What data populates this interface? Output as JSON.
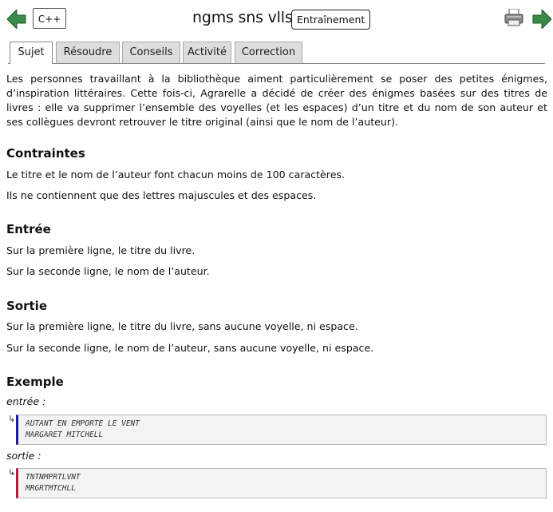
{
  "header": {
    "language": "C++",
    "title": "ngms sns vlls",
    "mode": "Entraînement"
  },
  "tabs": [
    {
      "label": "Sujet",
      "active": true
    },
    {
      "label": "Résoudre",
      "active": false
    },
    {
      "label": "Conseils",
      "active": false
    },
    {
      "label": "Activité",
      "active": false
    },
    {
      "label": "Correction",
      "active": false
    }
  ],
  "statement": {
    "intro": "Les personnes travaillant à la bibliothèque aiment particulièrement se poser des petites énigmes, d’inspiration litté­raires. Cette fois-ci, Agrarelle a décidé de créer des énigmes basées sur des titres de livres : elle va supprimer l’ensemble des voyelles (et les espaces) d’un titre et du nom de son auteur et ses collègues devront retrouver le titre original (ainsi que le nom de l’auteur).",
    "constraints_heading": "Contraintes",
    "constraints": [
      "Le titre et le nom de l’auteur font chacun moins de 100 caractères.",
      "Ils ne contiennent que des lettres majuscules et des espaces."
    ],
    "input_heading": "Entrée",
    "input": [
      "Sur la première ligne, le titre du livre.",
      "Sur la seconde ligne, le nom de l’auteur."
    ],
    "output_heading": "Sortie",
    "output": [
      "Sur la première ligne, le titre du livre, sans aucune voyelle, ni espace.",
      "Sur la seconde ligne, le nom de l’auteur, sans aucune voyelle, ni espace."
    ],
    "example_heading": "Exemple",
    "example_input_label": "entrée :",
    "example_input": "AUTANT EN EMPORTE LE VENT\nMARGARET MITCHELL",
    "example_output_label": "sortie :",
    "example_output": "TNTNMPRTLVNT\nMRGRTMTCHLL",
    "return_glyph": "↳"
  },
  "colors": {
    "nav_arrow": "#2e8b57",
    "input_bar": "#1a1aa8",
    "output_bar": "#c0182e"
  }
}
